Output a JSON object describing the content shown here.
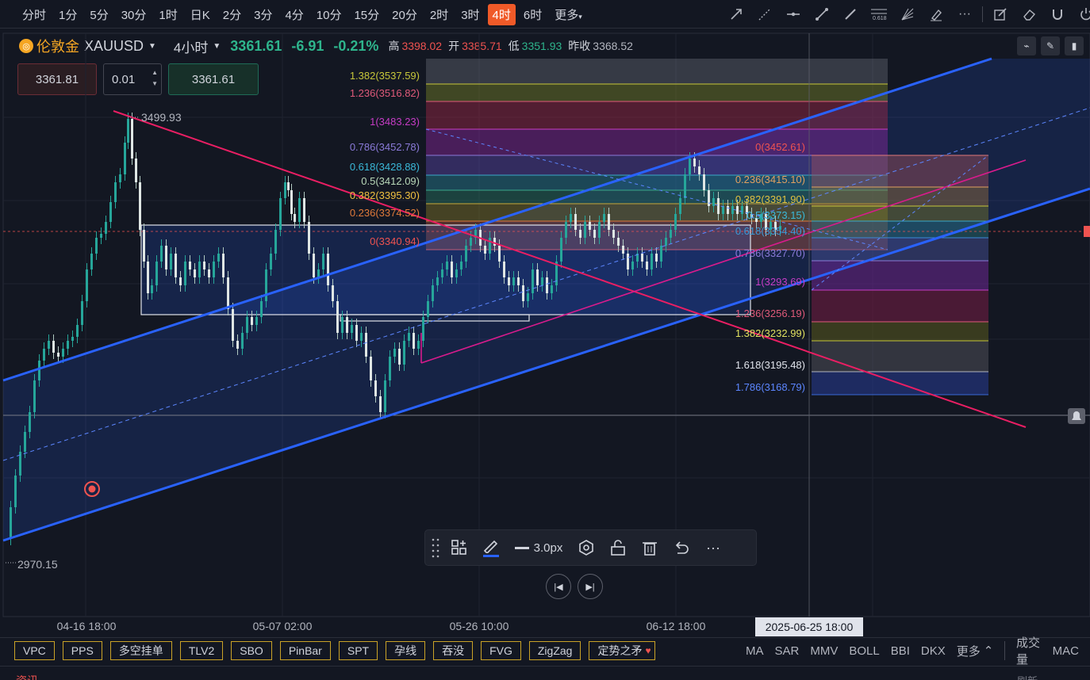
{
  "intervals": [
    "分时",
    "1分",
    "5分",
    "30分",
    "1时",
    "日K",
    "2分",
    "3分",
    "4分",
    "10分",
    "15分",
    "20分",
    "2时",
    "3时",
    "4时",
    "6时",
    "更多"
  ],
  "active_interval": "4时",
  "symbol": {
    "name": "伦敦金",
    "code": "XAUUSD",
    "timeframe": "4小时",
    "last": "3361.61",
    "change": "-6.91",
    "change_pct": "-0.21%",
    "high_label": "高",
    "high": "3398.02",
    "open_label": "开",
    "open": "3385.71",
    "low_label": "低",
    "low": "3351.93",
    "prev_label": "昨收",
    "prev": "3368.52"
  },
  "order": {
    "sell": "3361.81",
    "qty": "0.01",
    "buy": "3361.61"
  },
  "price_marks": {
    "high_mark": "3499.93",
    "low_mark": "2970.15"
  },
  "fib_left": [
    "1.382(3537.59)",
    "1.236(3516.82)",
    "1(3483.23)",
    "0.786(3452.78)",
    "0.618(3428.88)",
    "0.5(3412.09)",
    "0.382(3395.30)",
    "0.236(3374.52)",
    "0(3340.94)"
  ],
  "fib_right": [
    "0(3452.61)",
    "0.236(3415.10)",
    "0.382(3391.90)",
    "0.5(3373.15)",
    "0.618(3354.40)",
    "0.786(3327.70)",
    "1(3293.69)",
    "1.236(3256.19)",
    "1.382(3232.99)",
    "1.618(3195.48)",
    "1.786(3168.79)"
  ],
  "time_labels": [
    "04-16 18:00",
    "05-07 02:00",
    "05-26 10:00",
    "06-12 18:00"
  ],
  "crosshair_time": "2025-06-25 18:00",
  "float_toolbar": {
    "width_label": "3.0px"
  },
  "indicators_left": [
    "VPC",
    "PPS",
    "多空挂单",
    "TLV2",
    "SBO",
    "PinBar",
    "SPT",
    "孕线",
    "吞没",
    "FVG",
    "ZigZag",
    "定势之矛"
  ],
  "indicators_right": [
    "MA",
    "SAR",
    "MMV",
    "BOLL",
    "BBI",
    "DKX",
    "更多"
  ],
  "indicators_right2": [
    "成交量",
    "MAC"
  ],
  "bottom": {
    "left": "资讯",
    "right": "刷新"
  },
  "colors": {
    "up": "#26a69a",
    "down": "#ef5350",
    "channel": "#2962ff",
    "pink": "#e91e63",
    "accent": "#f05a28"
  }
}
